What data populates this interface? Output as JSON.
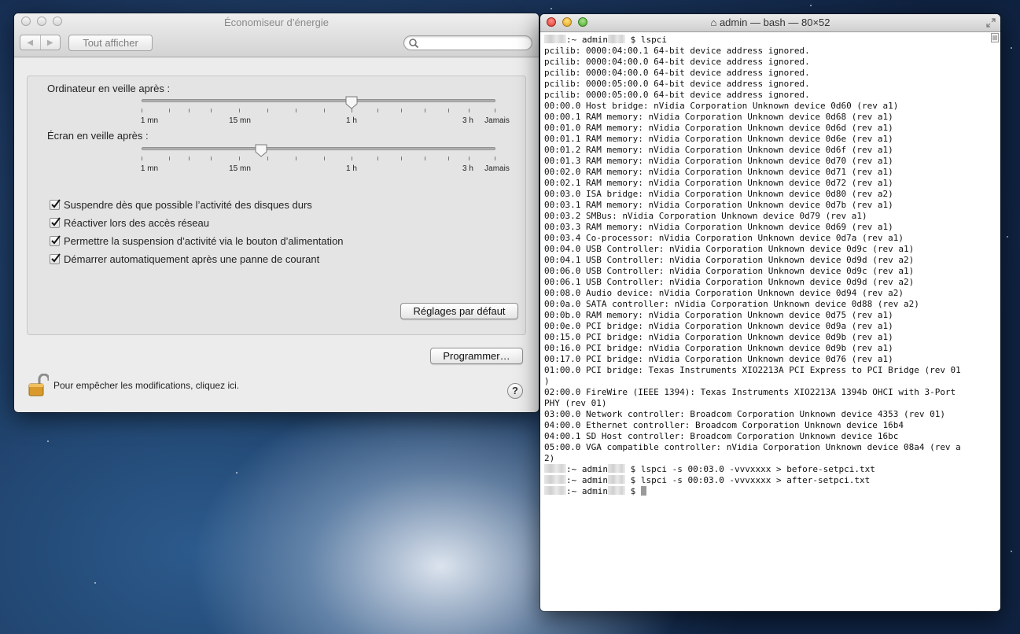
{
  "preferences": {
    "title": "Économiseur d’énergie",
    "toolbar": {
      "back_icon": "chevron-left-icon",
      "forward_icon": "chevron-right-icon",
      "show_all": "Tout afficher",
      "search_placeholder": ""
    },
    "computer_sleep": {
      "label": "Ordinateur en veille après :",
      "value": "1 h",
      "ticks": [
        "1 mn",
        "15 mn",
        "1 h",
        "3 h",
        "Jamais"
      ]
    },
    "display_sleep": {
      "label": "Écran en veille après :",
      "value": "between 15 mn and 1 h",
      "ticks": [
        "1 mn",
        "15 mn",
        "1 h",
        "3 h",
        "Jamais"
      ]
    },
    "options": [
      {
        "label": "Suspendre dès que possible l’activité des disques durs",
        "checked": true
      },
      {
        "label": "Réactiver lors des accès réseau",
        "checked": true
      },
      {
        "label": "Permettre la suspension d’activité via le bouton d’alimentation",
        "checked": true
      },
      {
        "label": "Démarrer automatiquement après une panne de courant",
        "checked": true
      }
    ],
    "defaults_button": "Réglages par défaut",
    "schedule_button": "Programmer…",
    "lock_text": "Pour empêcher les modifications, cliquez ici.",
    "help": "?"
  },
  "terminal": {
    "title": "admin — bash — 80×52",
    "prompt_suffix": ":~ admin",
    "lines": [
      ":~ admin $ lspci",
      "pcilib: 0000:04:00.1 64-bit device address ignored.",
      "pcilib: 0000:04:00.0 64-bit device address ignored.",
      "pcilib: 0000:04:00.0 64-bit device address ignored.",
      "pcilib: 0000:05:00.0 64-bit device address ignored.",
      "pcilib: 0000:05:00.0 64-bit device address ignored.",
      "00:00.0 Host bridge: nVidia Corporation Unknown device 0d60 (rev a1)",
      "00:00.1 RAM memory: nVidia Corporation Unknown device 0d68 (rev a1)",
      "00:01.0 RAM memory: nVidia Corporation Unknown device 0d6d (rev a1)",
      "00:01.1 RAM memory: nVidia Corporation Unknown device 0d6e (rev a1)",
      "00:01.2 RAM memory: nVidia Corporation Unknown device 0d6f (rev a1)",
      "00:01.3 RAM memory: nVidia Corporation Unknown device 0d70 (rev a1)",
      "00:02.0 RAM memory: nVidia Corporation Unknown device 0d71 (rev a1)",
      "00:02.1 RAM memory: nVidia Corporation Unknown device 0d72 (rev a1)",
      "00:03.0 ISA bridge: nVidia Corporation Unknown device 0d80 (rev a2)",
      "00:03.1 RAM memory: nVidia Corporation Unknown device 0d7b (rev a1)",
      "00:03.2 SMBus: nVidia Corporation Unknown device 0d79 (rev a1)",
      "00:03.3 RAM memory: nVidia Corporation Unknown device 0d69 (rev a1)",
      "00:03.4 Co-processor: nVidia Corporation Unknown device 0d7a (rev a1)",
      "00:04.0 USB Controller: nVidia Corporation Unknown device 0d9c (rev a1)",
      "00:04.1 USB Controller: nVidia Corporation Unknown device 0d9d (rev a2)",
      "00:06.0 USB Controller: nVidia Corporation Unknown device 0d9c (rev a1)",
      "00:06.1 USB Controller: nVidia Corporation Unknown device 0d9d (rev a2)",
      "00:08.0 Audio device: nVidia Corporation Unknown device 0d94 (rev a2)",
      "00:0a.0 SATA controller: nVidia Corporation Unknown device 0d88 (rev a2)",
      "00:0b.0 RAM memory: nVidia Corporation Unknown device 0d75 (rev a1)",
      "00:0e.0 PCI bridge: nVidia Corporation Unknown device 0d9a (rev a1)",
      "00:15.0 PCI bridge: nVidia Corporation Unknown device 0d9b (rev a1)",
      "00:16.0 PCI bridge: nVidia Corporation Unknown device 0d9b (rev a1)",
      "00:17.0 PCI bridge: nVidia Corporation Unknown device 0d76 (rev a1)",
      "01:00.0 PCI bridge: Texas Instruments XIO2213A PCI Express to PCI Bridge (rev 01",
      ")",
      "02:00.0 FireWire (IEEE 1394): Texas Instruments XIO2213A 1394b OHCI with 3-Port",
      "PHY (rev 01)",
      "03:00.0 Network controller: Broadcom Corporation Unknown device 4353 (rev 01)",
      "04:00.0 Ethernet controller: Broadcom Corporation Unknown device 16b4",
      "04:00.1 SD Host controller: Broadcom Corporation Unknown device 16bc",
      "05:00.0 VGA compatible controller: nVidia Corporation Unknown device 08a4 (rev a",
      "2)",
      ":~ admin $ lspci -s 00:03.0 -vvvxxxx > before-setpci.txt",
      ":~ admin $ lspci -s 00:03.0 -vvvxxxx > after-setpci.txt",
      ":~ admin $ "
    ]
  }
}
